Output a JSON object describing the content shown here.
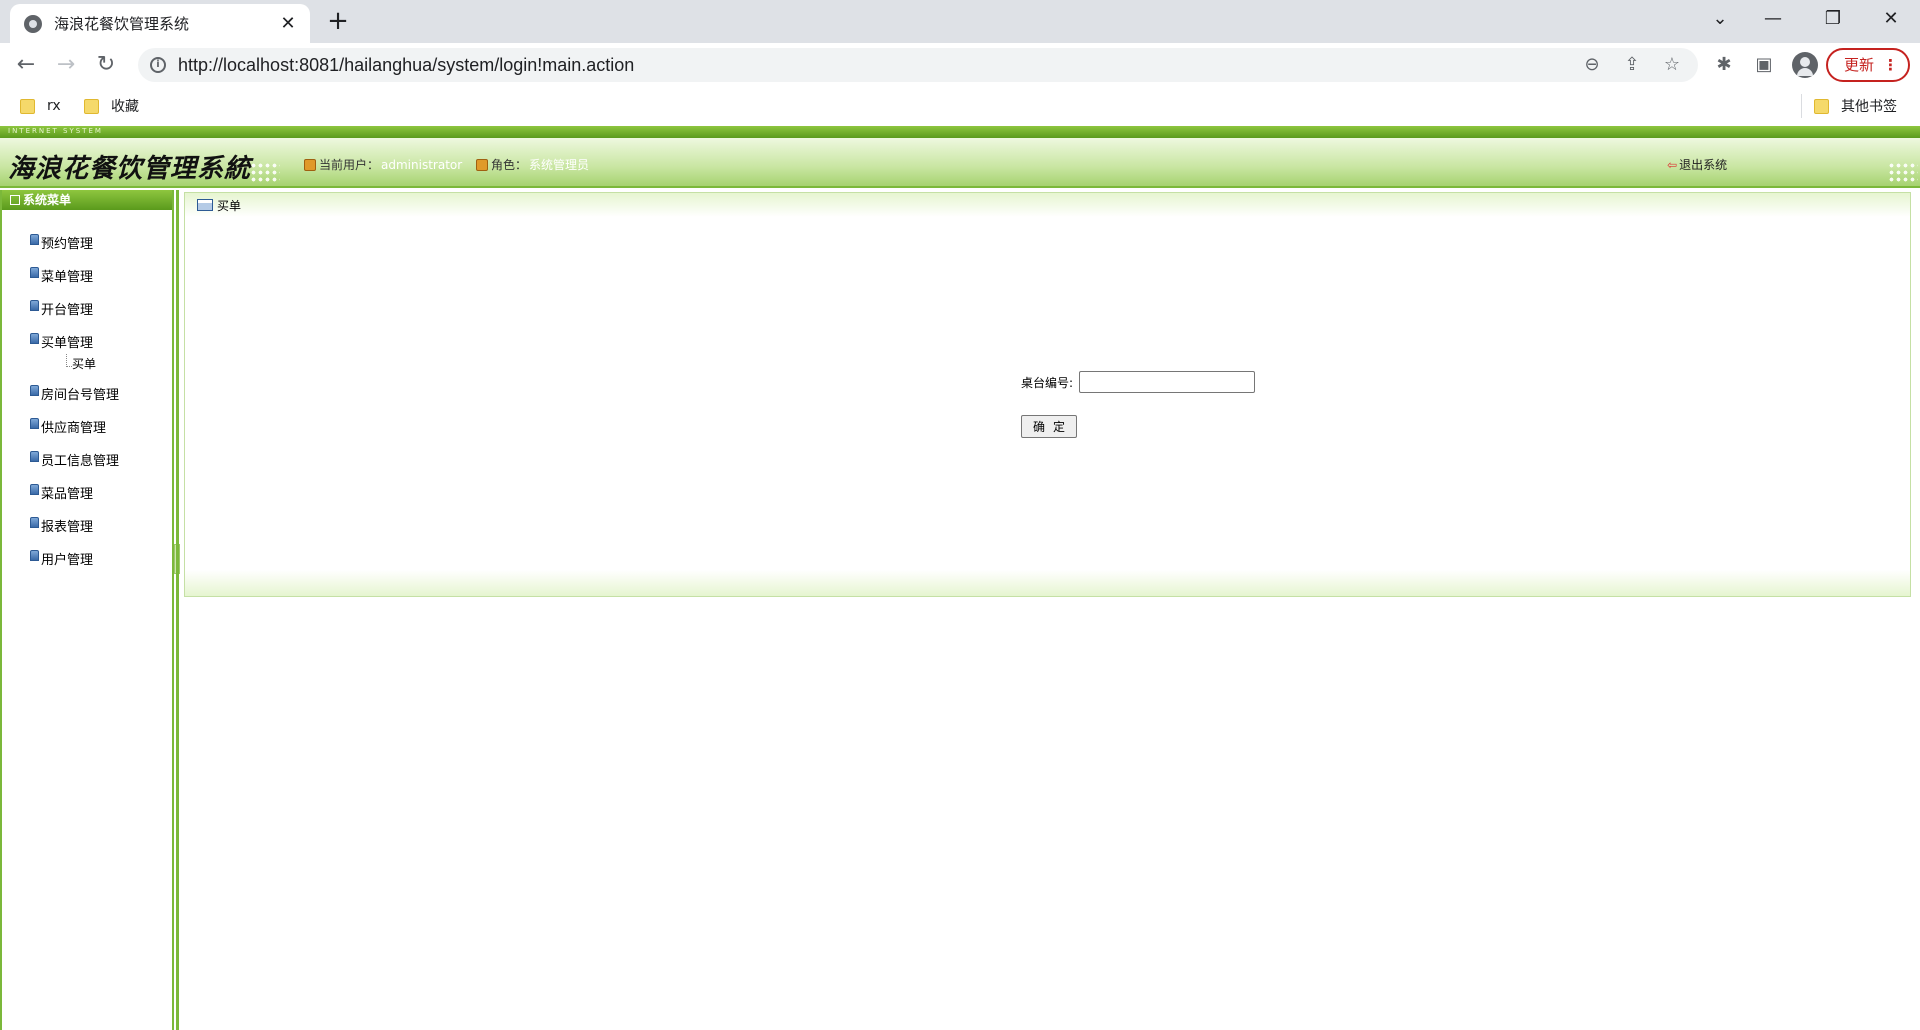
{
  "browser": {
    "tab_title": "海浪花餐饮管理系统",
    "tab_close": "✕",
    "new_tab": "+",
    "url": "http://localhost:8081/hailanghua/system/login!main.action",
    "update_label": "更新",
    "update_menu": "⋮",
    "bookmarks": [
      "rx",
      "收藏"
    ],
    "other_bookmarks": "其他书签"
  },
  "app": {
    "top_label": "INTERNET SYSTEM",
    "logo": "海浪花餐饮管理系統",
    "current_user_label": "当前用户：",
    "current_user": "administrator",
    "role_label": "角色：",
    "role": "系统管理员",
    "logout": "退出系统"
  },
  "sidebar": {
    "title": "系统菜单",
    "items": [
      {
        "label": "预约管理"
      },
      {
        "label": "菜单管理"
      },
      {
        "label": "开台管理"
      },
      {
        "label": "买单管理",
        "children": [
          "买单"
        ]
      },
      {
        "label": "房间台号管理"
      },
      {
        "label": "供应商管理"
      },
      {
        "label": "员工信息管理"
      },
      {
        "label": "菜品管理"
      },
      {
        "label": "报表管理"
      },
      {
        "label": "用户管理"
      }
    ]
  },
  "main": {
    "title": "买单",
    "table_no_label": "桌台编号:",
    "table_no_value": "",
    "submit_label": "确定"
  }
}
